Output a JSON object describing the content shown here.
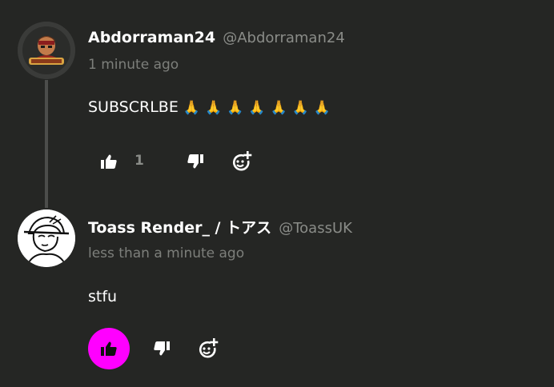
{
  "comments": [
    {
      "author": "Abdorraman24",
      "handle": "@Abdorraman24",
      "timestamp": "1 minute ago",
      "text": "SUBSCRLBE",
      "emoji": [
        "🙏",
        "🙏",
        "🙏",
        "🙏",
        "🙏",
        "🙏",
        "🙏"
      ],
      "like_count": "1",
      "liked": false
    },
    {
      "author": "Toass Render_ / トアス",
      "handle": "@ToassUK",
      "timestamp": "less than a minute ago",
      "text": "stfu",
      "liked": true
    }
  ],
  "icons": {
    "like": "thumbs-up-icon",
    "dislike": "thumbs-down-icon",
    "react": "add-reaction-icon"
  },
  "colors": {
    "background": "#252624",
    "like_active": "#ff00ff",
    "text_primary": "#ffffff",
    "text_muted": "#8a8c88"
  }
}
